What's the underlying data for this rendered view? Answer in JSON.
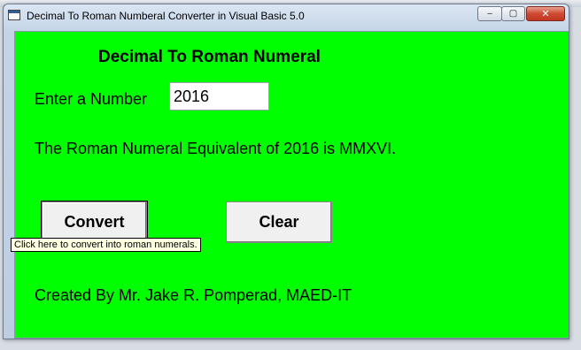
{
  "window": {
    "title": "Decimal To Roman Numberal Converter in Visual Basic 5.0",
    "controls": {
      "minimize": "‒",
      "maximize": "▢",
      "close": "✕"
    }
  },
  "form": {
    "heading": "Decimal To Roman Numeral",
    "input_label": "Enter a Number",
    "input_value": "2016",
    "result_text": "The Roman Numeral Equivalent of 2016 is MMXVI.",
    "convert_label": "Convert",
    "clear_label": "Clear",
    "tooltip": "Click here to convert into roman numerals.",
    "credit": "Created By Mr. Jake R. Pomperad, MAED-IT",
    "background_color": "#00ff00"
  }
}
